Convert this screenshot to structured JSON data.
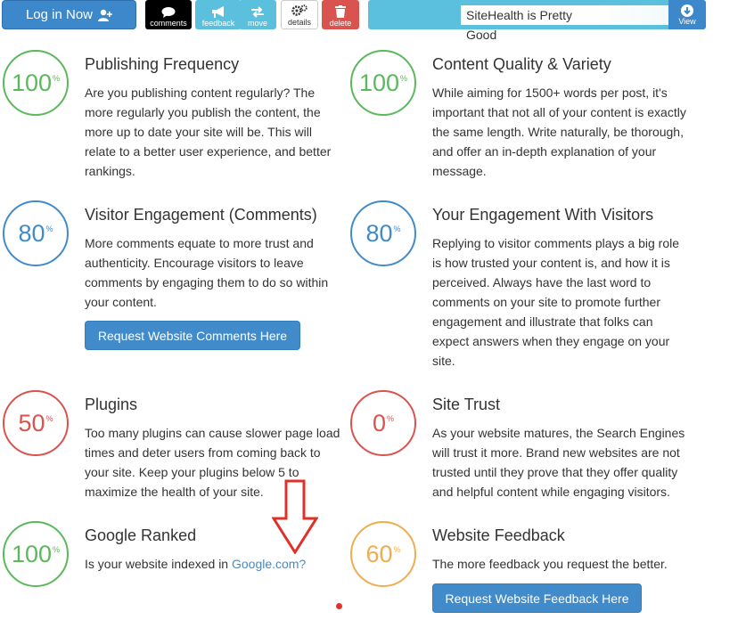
{
  "toolbar": {
    "login_label": "Log in Now",
    "comments_label": "comments",
    "feedback_label": "feedback",
    "move_label": "move",
    "details_label": "details",
    "delete_label": "delete",
    "health_text": "SiteHealth is Pretty Good",
    "view_label": "View"
  },
  "colors": {
    "green": "#5cb85c",
    "blue": "#428bca",
    "red": "#d9534f",
    "orange": "#f0ad4e",
    "info": "#5bc0de"
  },
  "metrics": {
    "publishing": {
      "score": "100",
      "pct": "%",
      "title": "Publishing Frequency",
      "desc": "Are you publishing content regularly? The more regularly you publish the content, the more up to date your site will be. This will relate to a better user experience, and better rankings."
    },
    "content": {
      "score": "100",
      "pct": "%",
      "title": "Content Quality & Variety",
      "desc": "While aiming for 1500+ words per post, it's important that not all of your content is exactly the same length. Write naturally, be thorough, and offer an in-depth explanation of your message."
    },
    "visitor": {
      "score": "80",
      "pct": "%",
      "title": "Visitor Engagement (Comments)",
      "desc": "More comments equate to more trust and authenticity. Encourage visitors to leave comments by engaging them to do so within your content.",
      "button": "Request Website Comments Here"
    },
    "your_engagement": {
      "score": "80",
      "pct": "%",
      "title": "Your Engagement With Visitors",
      "desc": "Replying to visitor comments plays a big role is how trusted your content is, and how it is perceived. Always have the last word to comments on your site to promote further engagement and illustrate that folks can expect answers when they engage on your site."
    },
    "plugins": {
      "score": "50",
      "pct": "%",
      "title": "Plugins",
      "desc": "Too many plugins can cause slower page load times and deter users from coming back to your site. Keep your plugins below 5 to maximize the health of your site."
    },
    "trust": {
      "score": "0",
      "pct": "%",
      "title": "Site Trust",
      "desc": "As your website matures, the Search Engines will trust it more. Brand new websites are not trusted until they prove that they offer quality and helpful content while engaging visitors."
    },
    "google": {
      "score": "100",
      "pct": "%",
      "title": "Google Ranked",
      "desc": "Is your website indexed in",
      "link": "Google.com?"
    },
    "feedback": {
      "score": "60",
      "pct": "%",
      "title": "Website Feedback",
      "desc": "The more feedback you request the better.",
      "button": "Request Website Feedback Here"
    }
  }
}
